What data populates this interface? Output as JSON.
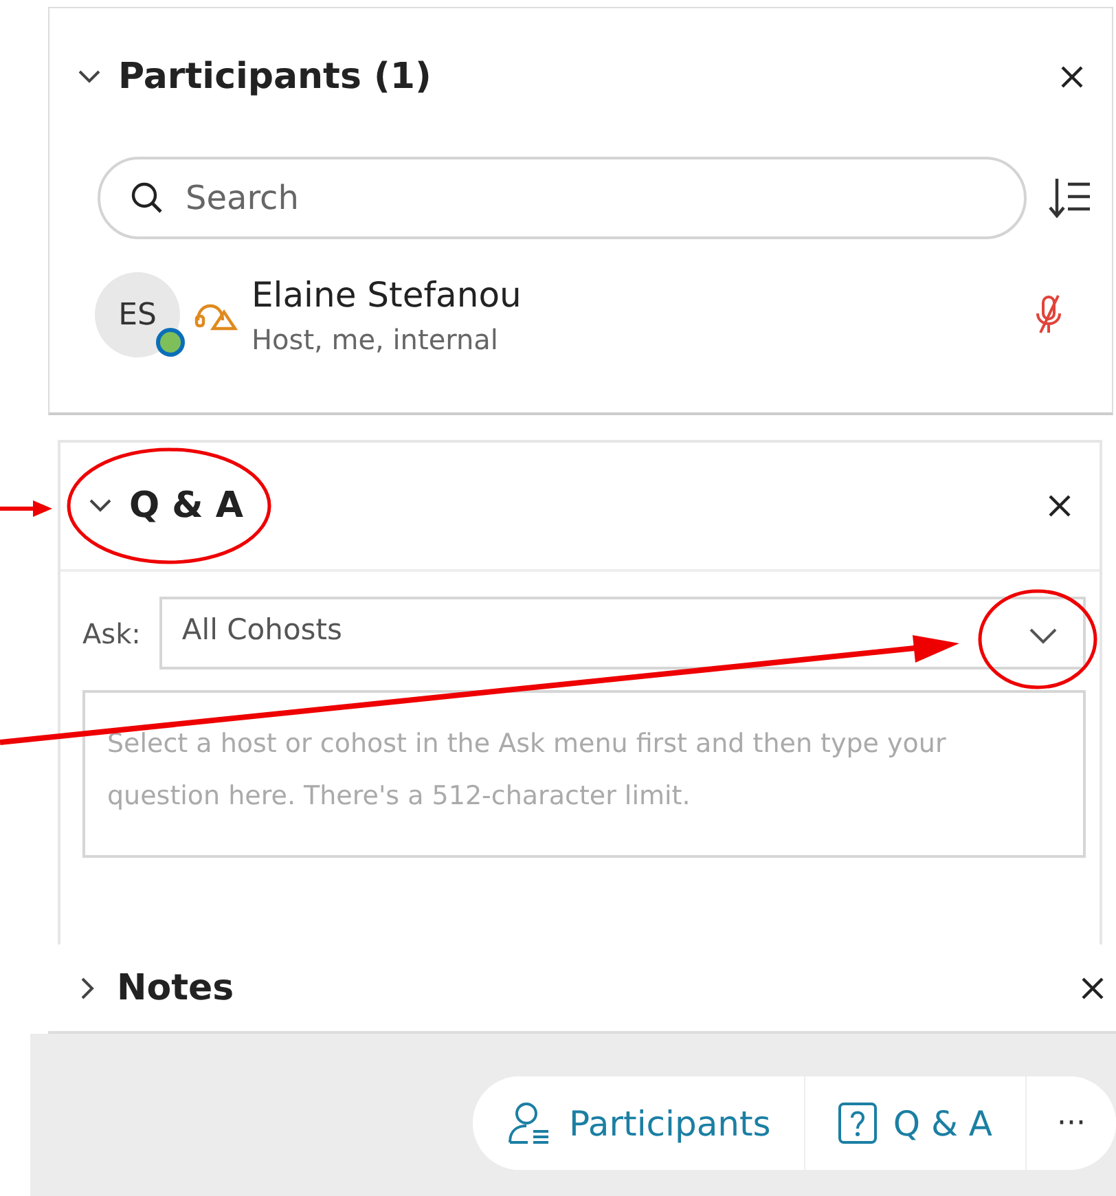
{
  "participants": {
    "title": "Participants (1)",
    "expanded": true,
    "search": {
      "placeholder": "Search"
    },
    "people": [
      {
        "initials": "ES",
        "name": "Elaine Stefanou",
        "role": "Host, me, internal",
        "muted": true
      }
    ]
  },
  "qa": {
    "title": "Q & A",
    "expanded": true,
    "ask_label": "Ask:",
    "ask_value": "All Cohosts",
    "question": {
      "placeholder": "Select a host or cohost in the Ask menu first and then type your question here. There's a 512-character limit."
    }
  },
  "notes": {
    "title": "Notes",
    "expanded": false
  },
  "toolbar": [
    {
      "kind": "participants",
      "label": "Participants"
    },
    {
      "kind": "qa",
      "label": "Q & A"
    },
    {
      "kind": "more",
      "label": "···"
    }
  ]
}
